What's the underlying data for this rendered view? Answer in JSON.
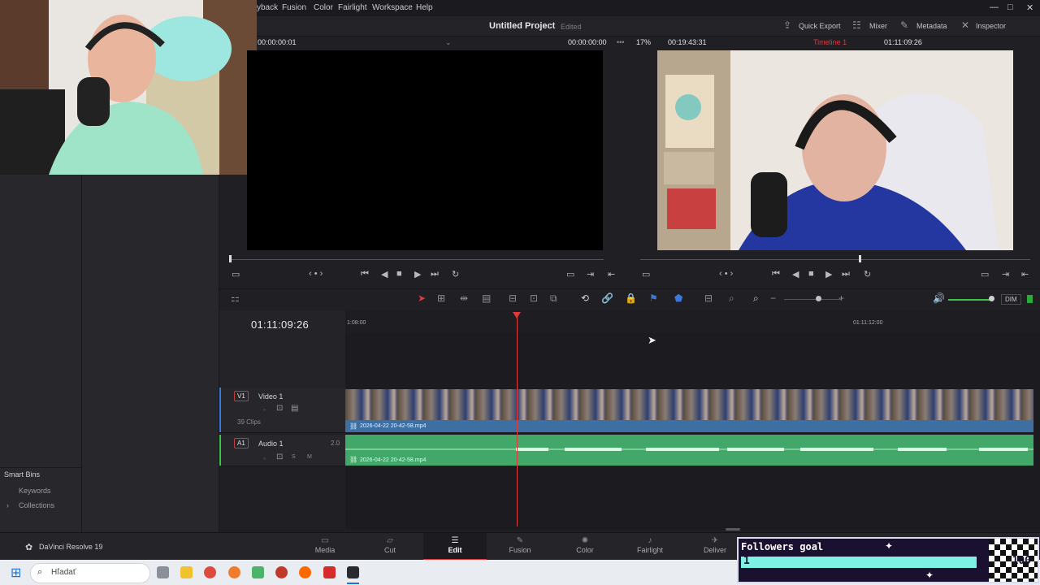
{
  "menu": [
    "yback",
    "Fusion",
    "Color",
    "Fairlight",
    "Workspace",
    "Help"
  ],
  "window_controls": [
    "—",
    "□",
    "✕"
  ],
  "header": {
    "project_title": "Untitled Project",
    "edited": "Edited",
    "buttons": [
      "Quick Export",
      "Mixer",
      "Metadata",
      "Inspector"
    ]
  },
  "source_viewer": {
    "timecode_left": "00:00:00:01",
    "timecode_right": "00:00:00:00"
  },
  "program_viewer": {
    "zoom": "17%",
    "duration": "00:19:43:31",
    "timeline_name": "Timeline 1",
    "timecode": "01:11:09:26"
  },
  "timeline": {
    "current_timecode": "01:11:09:26",
    "ruler_labels": [
      "1:08:00",
      "01:11:12:00"
    ],
    "video_track": {
      "badge": "V1",
      "name": "Video 1",
      "clips": "39 Clips",
      "clip_name": "2026-04-22 20-42-58.mp4"
    },
    "audio_track": {
      "badge": "A1",
      "name": "Audio 1",
      "channels": "2.0",
      "clip_name": "2026-04-22 20-42-58.mp4",
      "buttons": [
        "S",
        "M"
      ]
    },
    "audio_level_label": "DIM"
  },
  "left_panel": {
    "smart_bins": "Smart Bins",
    "items": [
      "Keywords",
      "Collections"
    ]
  },
  "app_name": "DaVinci Resolve 19",
  "pages": [
    "Media",
    "Cut",
    "Edit",
    "Fusion",
    "Color",
    "Fairlight",
    "Deliver"
  ],
  "active_page": "Edit",
  "taskbar": {
    "search_placeholder": "Hľadať"
  },
  "followers_goal": {
    "title": "Followers goal",
    "current": "1",
    "goal": "100",
    "progress": 0.01
  },
  "colors": {
    "accent_red": "#e0383b",
    "video_clip": "#3d6fa3",
    "audio_clip": "#42a86a",
    "goal_bar": "#7ff0e4"
  }
}
